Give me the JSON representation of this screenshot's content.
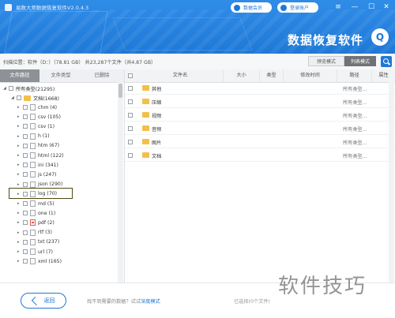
{
  "app": {
    "title": "易数大师数据恢复软件V2.0.4.3",
    "brand_text": "数据恢复软件",
    "brand_logo_text": "Q"
  },
  "header": {
    "member_button": "数据会员",
    "login_button": "登录账户"
  },
  "infobar": {
    "scan_location": "扫描位置：软件（D：）（78.81 GB）  共23,287个文件（共4.87 GB）",
    "preview_mode": "预览模式",
    "list_mode": "列表模式"
  },
  "tabs": [
    {
      "label": "文件路径",
      "active": true
    },
    {
      "label": "文件类型",
      "active": false
    },
    {
      "label": "已删除",
      "active": false
    }
  ],
  "tree": {
    "root": "所有类型(21295)",
    "doc_group": "文档(1668)",
    "items": [
      {
        "label": "chm (4)",
        "icon": "document-icon",
        "red": false
      },
      {
        "label": "csv (105)",
        "icon": "document-icon",
        "red": false
      },
      {
        "label": "csv (1)",
        "icon": "document-icon",
        "red": false
      },
      {
        "label": "h (1)",
        "icon": "document-icon",
        "red": false
      },
      {
        "label": "htm (67)",
        "icon": "document-icon",
        "red": false
      },
      {
        "label": "html (122)",
        "icon": "document-icon",
        "red": false
      },
      {
        "label": "ini (341)",
        "icon": "document-icon",
        "red": false
      },
      {
        "label": "js (247)",
        "icon": "document-icon",
        "red": false
      },
      {
        "label": "json (290)",
        "icon": "document-icon",
        "red": false
      },
      {
        "label": "log (70)",
        "icon": "document-icon",
        "red": false
      },
      {
        "label": "md (5)",
        "icon": "document-icon",
        "red": false
      },
      {
        "label": "one (1)",
        "icon": "document-icon",
        "red": false
      },
      {
        "label": "pdf (2)",
        "icon": "pdf-icon",
        "red": true
      },
      {
        "label": "rtf (3)",
        "icon": "document-icon",
        "red": false
      },
      {
        "label": "txt (237)",
        "icon": "document-icon",
        "red": false
      },
      {
        "label": "url (7)",
        "icon": "document-icon",
        "red": false
      },
      {
        "label": "xml (165)",
        "icon": "document-icon",
        "red": false
      }
    ]
  },
  "table": {
    "headers": [
      "文件名",
      "大小",
      "类型",
      "修改时间",
      "路径",
      "属性"
    ],
    "rows": [
      {
        "name": "其他",
        "path": "所有类型..."
      },
      {
        "name": "压缩",
        "path": "所有类型..."
      },
      {
        "name": "视频",
        "path": "所有类型..."
      },
      {
        "name": "音频",
        "path": "所有类型..."
      },
      {
        "name": "图片",
        "path": "所有类型..."
      },
      {
        "name": "文档",
        "path": "所有类型..."
      }
    ]
  },
  "footer": {
    "back_label": "返回",
    "hint_text": "找不到需要的数据？试试",
    "hint_link": "深度模式",
    "selected_text": "已选择(0个文件)"
  },
  "watermark": "软件技巧",
  "colors": {
    "brand_blue": "#1f78d6",
    "highlight_border": "#4f4a14",
    "folder_yellow": "#f2c04a"
  }
}
